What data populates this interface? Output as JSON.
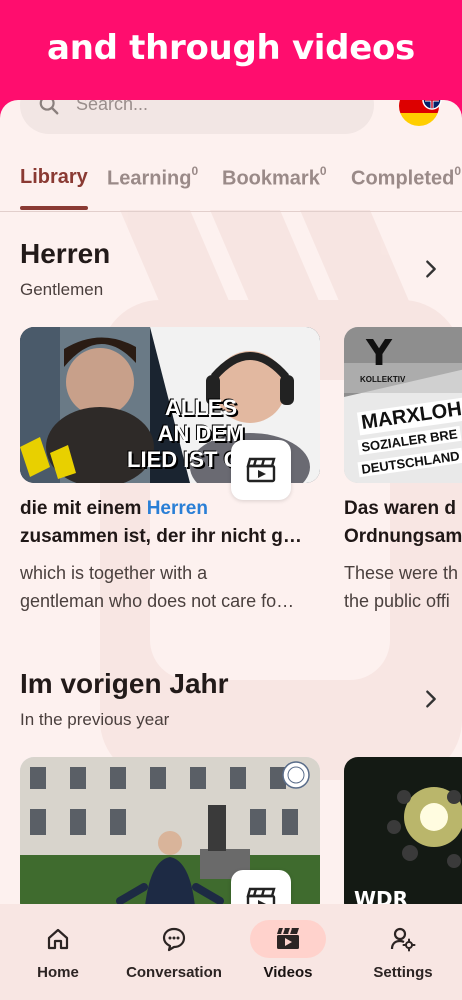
{
  "banner": {
    "text": "and through videos"
  },
  "search": {
    "placeholder": "Search..."
  },
  "tabs": [
    {
      "label": "Library",
      "count": ""
    },
    {
      "label": "Learning",
      "count": "0"
    },
    {
      "label": "Bookmark",
      "count": "0"
    },
    {
      "label": "Completed",
      "count": "0"
    }
  ],
  "sections": [
    {
      "title": "Herren",
      "subtitle": "Gentlemen",
      "cards": [
        {
          "image_text": [
            "ALLES",
            "AN DEM",
            "LIED IST GEIL"
          ],
          "title_pre": "die mit einem ",
          "title_highlight": "Herren",
          "title_line2": "zusammen ist, der ihr nicht g…",
          "trans_line1": "which is together with a",
          "trans_line2": "gentleman who does not care fo…"
        },
        {
          "image_text": [
            "Y",
            "KOLLEKTIV",
            "MARXLOH",
            "SOZIALER BRE",
            "DEUTSCHLAND"
          ],
          "title_line1": "Das waren d",
          "title_line2": "Ordnungsam",
          "trans_line1": "These were th",
          "trans_line2": "the public offi"
        }
      ]
    },
    {
      "title": "Im vorigen Jahr",
      "subtitle": "In the previous year",
      "cards": [
        {
          "image_text": []
        },
        {
          "image_text": [
            "WDR"
          ]
        }
      ]
    }
  ],
  "nav": [
    {
      "label": "Home",
      "icon": "home-icon"
    },
    {
      "label": "Conversation",
      "icon": "chat-icon"
    },
    {
      "label": "Videos",
      "icon": "clapperboard-icon",
      "active": true
    },
    {
      "label": "Settings",
      "icon": "user-settings-icon"
    }
  ],
  "colors": {
    "banner": "#ff0d6e",
    "accent": "#8a3a33",
    "highlight": "#2a7fd6",
    "background": "#fdf1ef",
    "nav_active_pill": "#ffd2cc"
  }
}
